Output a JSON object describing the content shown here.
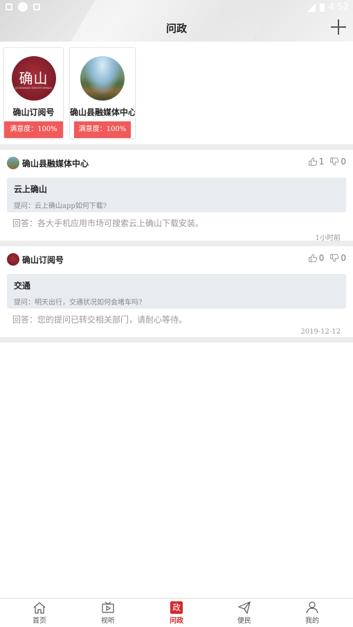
{
  "status_bar": {
    "time": "4:52"
  },
  "header": {
    "title": "问政"
  },
  "accounts": [
    {
      "name": "确山订阅号",
      "satisfaction": "满意度：100%",
      "avatar_text": "确山",
      "avatar_small": "QUESHAN DINGYUEHAO"
    },
    {
      "name": "确山县融媒体中心",
      "satisfaction": "满意度：100%"
    }
  ],
  "questions": [
    {
      "department": "确山县融媒体中心",
      "likes": "1",
      "dislikes": "0",
      "title": "云上确山",
      "question": "提问：云上确山app如何下载?",
      "answer": "回答：各大手机应用市场可搜索云上确山下载安装。",
      "time": "1小时前"
    },
    {
      "department": "确山订阅号",
      "likes": "0",
      "dislikes": "0",
      "title": "交通",
      "question": "提问：明天出行，交通状况如何会堵车吗?",
      "answer": "回答：您的提问已转交相关部门，请耐心等待。",
      "time": "2019-12-12"
    }
  ],
  "nav": [
    {
      "label": "首页",
      "icon": "home-icon"
    },
    {
      "label": "视听",
      "icon": "tv-icon"
    },
    {
      "label": "问政",
      "icon": "gov-icon",
      "badge": "政",
      "active": true
    },
    {
      "label": "便民",
      "icon": "paper-plane-icon"
    },
    {
      "label": "我的",
      "icon": "user-icon"
    }
  ],
  "colors": {
    "accent": "#d6262b",
    "satisfaction_bg": "#f05a5a",
    "question_bg": "#e8ebf0"
  }
}
